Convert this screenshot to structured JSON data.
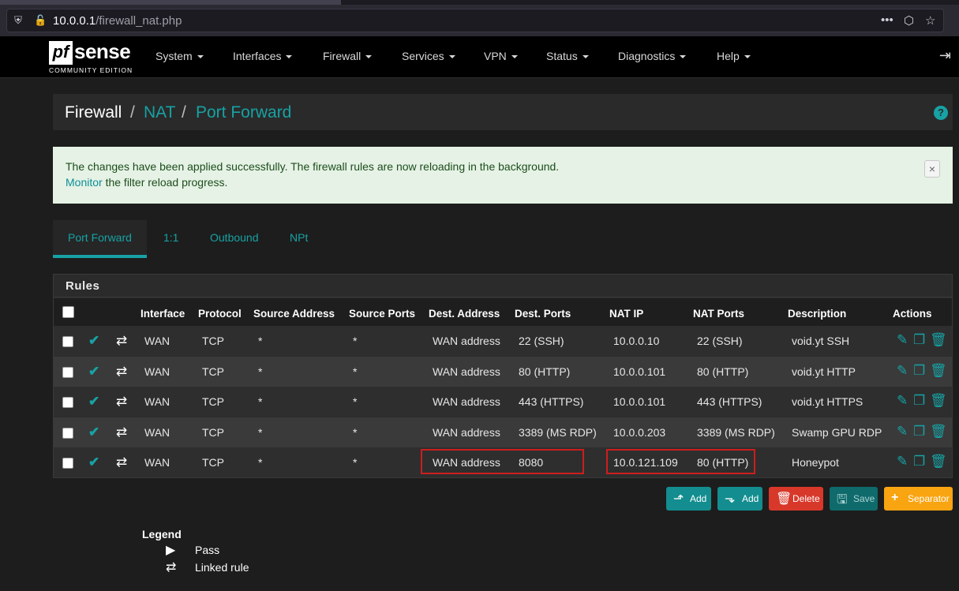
{
  "browser": {
    "url_host": "10.0.0.1",
    "url_path": "/firewall_nat.php"
  },
  "brand": {
    "logo_pf": "pf",
    "logo_sense": "sense",
    "edition": "COMMUNITY EDITION"
  },
  "nav": {
    "items": [
      "System",
      "Interfaces",
      "Firewall",
      "Services",
      "VPN",
      "Status",
      "Diagnostics",
      "Help"
    ]
  },
  "breadcrumb": {
    "root": "Firewall",
    "sep": "/",
    "nat": "NAT",
    "current": "Port Forward"
  },
  "alert": {
    "message": "The changes have been applied successfully. The firewall rules are now reloading in the background.",
    "monitor_link": "Monitor",
    "monitor_rest": " the filter reload progress.",
    "close": "×"
  },
  "tabs": [
    "Port Forward",
    "1:1",
    "Outbound",
    "NPt"
  ],
  "rules": {
    "title": "Rules",
    "headers": {
      "interface": "Interface",
      "protocol": "Protocol",
      "src_addr": "Source Address",
      "src_ports": "Source Ports",
      "dest_addr": "Dest. Address",
      "dest_ports": "Dest. Ports",
      "nat_ip": "NAT IP",
      "nat_ports": "NAT Ports",
      "description": "Description",
      "actions": "Actions"
    },
    "rows": [
      {
        "interface": "WAN",
        "protocol": "TCP",
        "src_addr": "*",
        "src_ports": "*",
        "dest_addr": "WAN address",
        "dest_ports": "22 (SSH)",
        "nat_ip": "10.0.0.10",
        "nat_ports": "22 (SSH)",
        "description": "void.yt SSH"
      },
      {
        "interface": "WAN",
        "protocol": "TCP",
        "src_addr": "*",
        "src_ports": "*",
        "dest_addr": "WAN address",
        "dest_ports": "80 (HTTP)",
        "nat_ip": "10.0.0.101",
        "nat_ports": "80 (HTTP)",
        "description": "void.yt HTTP"
      },
      {
        "interface": "WAN",
        "protocol": "TCP",
        "src_addr": "*",
        "src_ports": "*",
        "dest_addr": "WAN address",
        "dest_ports": "443 (HTTPS)",
        "nat_ip": "10.0.0.101",
        "nat_ports": "443 (HTTPS)",
        "description": "void.yt HTTPS"
      },
      {
        "interface": "WAN",
        "protocol": "TCP",
        "src_addr": "*",
        "src_ports": "*",
        "dest_addr": "WAN address",
        "dest_ports": "3389 (MS RDP)",
        "nat_ip": "10.0.0.203",
        "nat_ports": "3389 (MS RDP)",
        "description": "Swamp GPU RDP"
      },
      {
        "interface": "WAN",
        "protocol": "TCP",
        "src_addr": "*",
        "src_ports": "*",
        "dest_addr": "WAN address",
        "dest_ports": "8080",
        "nat_ip": "10.0.121.109",
        "nat_ports": "80 (HTTP)",
        "description": "Honeypot"
      }
    ]
  },
  "buttons": {
    "add_top": "Add",
    "add_bottom": "Add",
    "delete": "Delete",
    "save": "Save",
    "separator": "Separator"
  },
  "legend": {
    "title": "Legend",
    "pass": "Pass",
    "linked": "Linked rule"
  },
  "colors": {
    "accent": "#17a2a4",
    "danger": "#d8382a",
    "warning": "#f9a411",
    "highlight_box": "#cc1e1e"
  }
}
